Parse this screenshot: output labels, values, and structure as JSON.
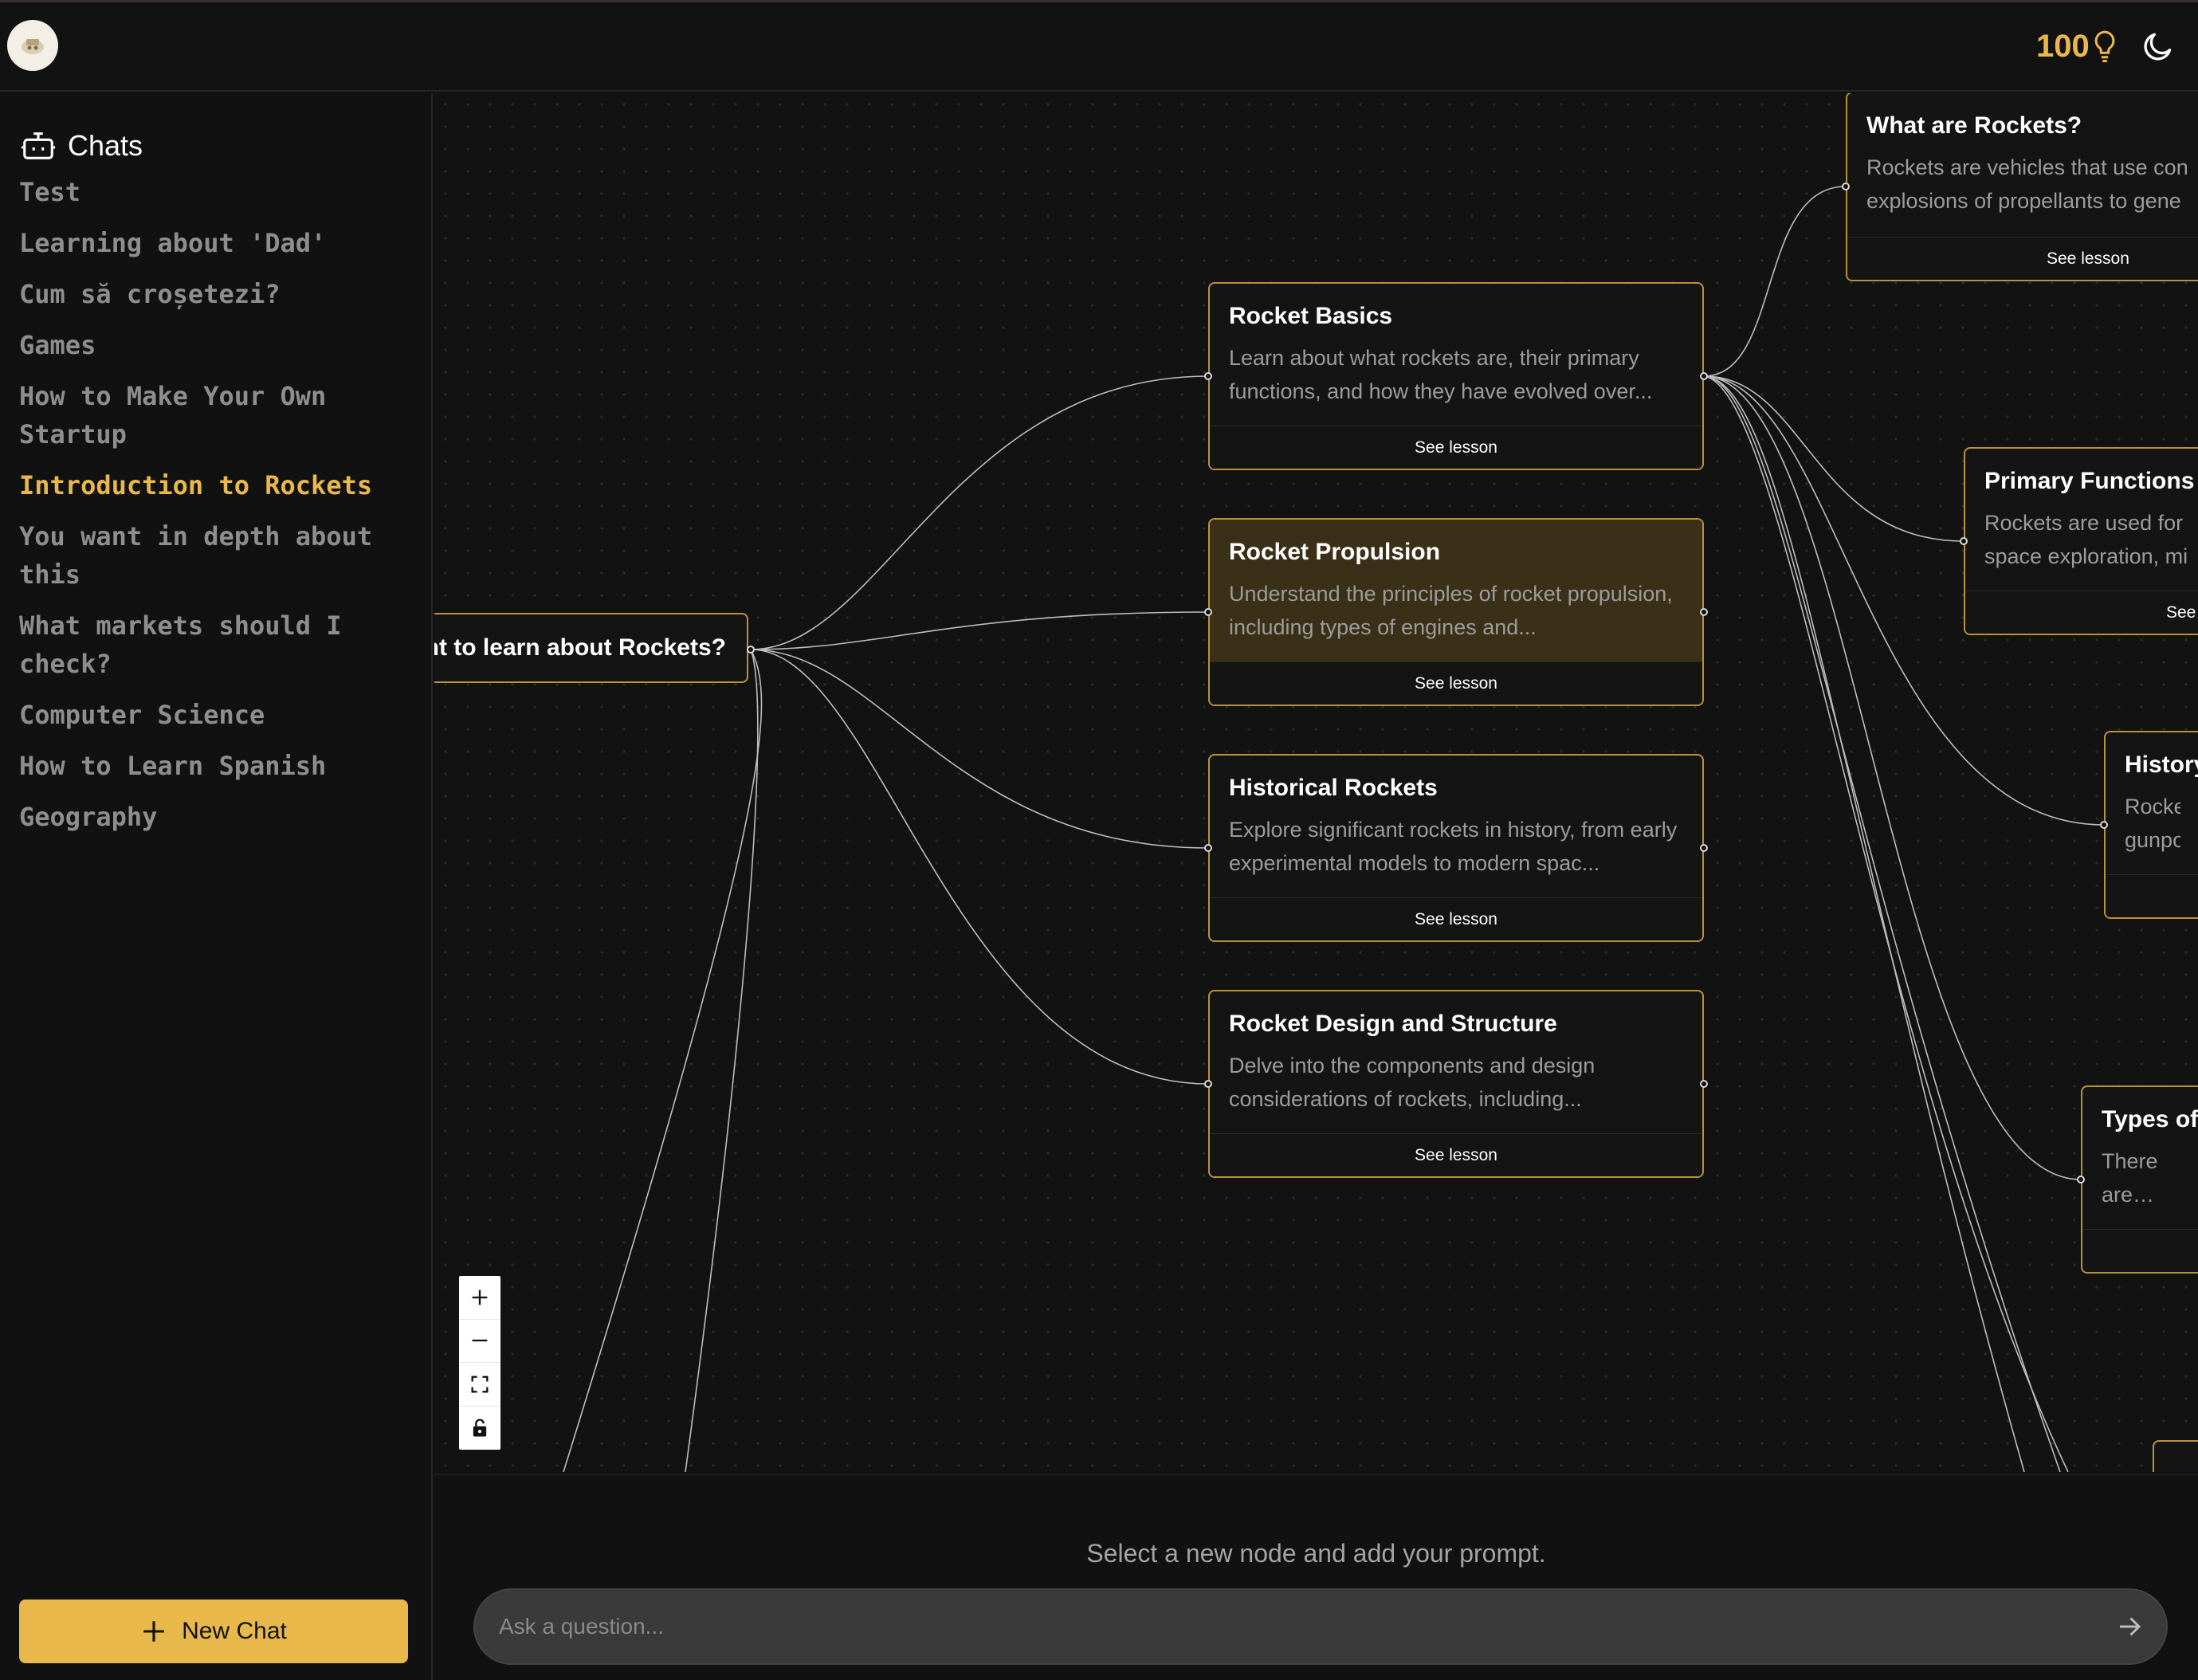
{
  "header": {
    "credits": "100",
    "icons": {
      "logo": "app-logo",
      "credits": "lightbulb-icon",
      "theme": "moon-icon"
    }
  },
  "sidebar": {
    "title": "Chats",
    "items": [
      {
        "label": "Test",
        "active": false
      },
      {
        "label": "Learning about 'Dad'",
        "active": false
      },
      {
        "label": "Cum să croșetezi?",
        "active": false
      },
      {
        "label": "Games",
        "active": false
      },
      {
        "label": "How to Make Your Own Startup",
        "active": false
      },
      {
        "label": "Introduction to Rockets",
        "active": true
      },
      {
        "label": "You want in depth about this",
        "active": false
      },
      {
        "label": "What markets should I check?",
        "active": false
      },
      {
        "label": "Computer Science",
        "active": false
      },
      {
        "label": "How to Learn Spanish",
        "active": false
      },
      {
        "label": "Geography",
        "active": false
      }
    ],
    "new_chat_label": "New Chat"
  },
  "canvas": {
    "root_label": "ant to learn about Rockets?",
    "nodes": [
      {
        "title": "Rocket Basics",
        "description": "Learn about what rockets are, their primary functions, and how they have evolved over...",
        "action": "See lesson"
      },
      {
        "title": "Rocket Propulsion",
        "description": "Understand the principles of rocket propulsion, including types of engines and...",
        "action": "See lesson"
      },
      {
        "title": "Historical Rockets",
        "description": "Explore significant rockets in history, from early experimental models to modern spac...",
        "action": "See lesson"
      },
      {
        "title": "Rocket Design and Structure",
        "description": "Delve into the components and design considerations of rockets, including...",
        "action": "See lesson"
      },
      {
        "title": "What are Rockets?",
        "description": "Rockets are vehicles that use con explosions of propellants to gene",
        "action": "See lesson"
      },
      {
        "title": "Primary Functions o",
        "description": "Rockets are used for space exploration, mi",
        "action": "See"
      },
      {
        "title": "History",
        "description": "Rocket: gunpow",
        "action": ""
      },
      {
        "title": "Types of",
        "description": "There are including",
        "action": ""
      }
    ],
    "controls": [
      "zoom-in",
      "zoom-out",
      "fit-view",
      "lock"
    ]
  },
  "prompt": {
    "hint": "Select a new node and add your prompt.",
    "placeholder": "Ask a question..."
  }
}
